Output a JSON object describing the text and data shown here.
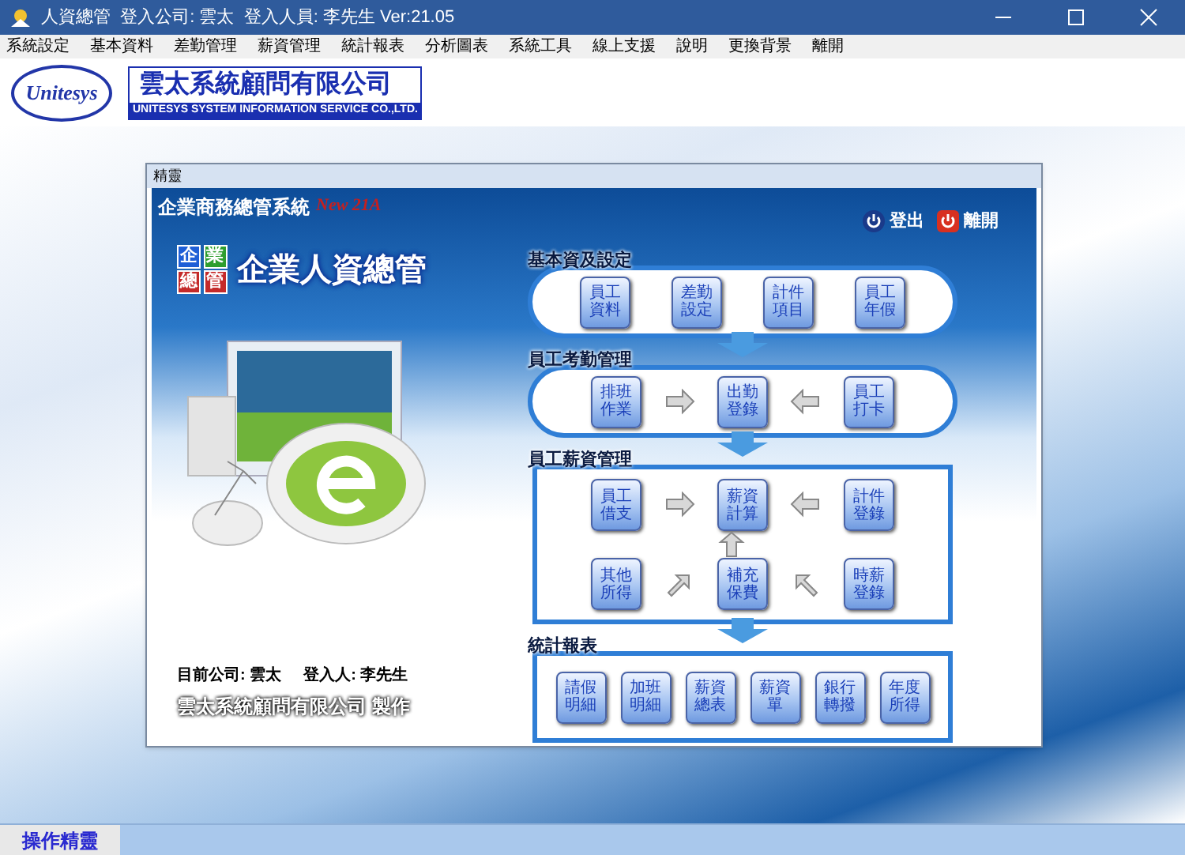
{
  "window": {
    "title": "人資總管  登入公司: 雲太  登入人員: 李先生 Ver:21.05"
  },
  "menu": [
    "系統設定",
    "基本資料",
    "差勤管理",
    "薪資管理",
    "統計報表",
    "分析圖表",
    "系統工具",
    "線上支援",
    "說明",
    "更換背景",
    "離開"
  ],
  "logo": {
    "emblem": "Unitesys",
    "company": "雲太系統顧問有限公司",
    "english": "UNITESYS SYSTEM INFORMATION SERVICE CO.,LTD."
  },
  "panel": {
    "title": "精靈",
    "system": "企業商務總管系統",
    "version": "New 21A",
    "actions": [
      {
        "label": "登出",
        "kind": "logout"
      },
      {
        "label": "離開",
        "kind": "exit"
      }
    ],
    "tiles": [
      {
        "char": "企",
        "color": "#1f5fd6"
      },
      {
        "char": "業",
        "color": "#2e9e2e"
      },
      {
        "char": "總",
        "color": "#c42a2a"
      },
      {
        "char": "管",
        "color": "#c42a2a"
      }
    ],
    "product": "企業人資總管",
    "sections": [
      {
        "title": "基本資及設定",
        "kind": "pill-row",
        "buttons": [
          "員工資料",
          "差勤設定",
          "計件項目",
          "員工年假"
        ]
      },
      {
        "title": "員工考勤管理",
        "kind": "pill-flow",
        "buttons": [
          "排班作業",
          "出勤登錄",
          "員工打卡"
        ]
      },
      {
        "title": "員工薪資管理",
        "kind": "box-grid",
        "buttons": [
          "員工借支",
          "薪資計算",
          "計件登錄",
          "其他所得",
          "補充保費",
          "時薪登錄"
        ]
      },
      {
        "title": "統計報表",
        "kind": "box-row",
        "buttons": [
          "請假明細",
          "加班明細",
          "薪資總表",
          "薪資單",
          "銀行轉撥",
          "年度所得"
        ]
      }
    ],
    "company_label": "目前公司: 雲太",
    "user_label": "登入人: 李先生",
    "credit": "雲太系統顧問有限公司 製作"
  },
  "bottom_tabs": [
    {
      "label": "操作精靈",
      "selected": true
    }
  ]
}
